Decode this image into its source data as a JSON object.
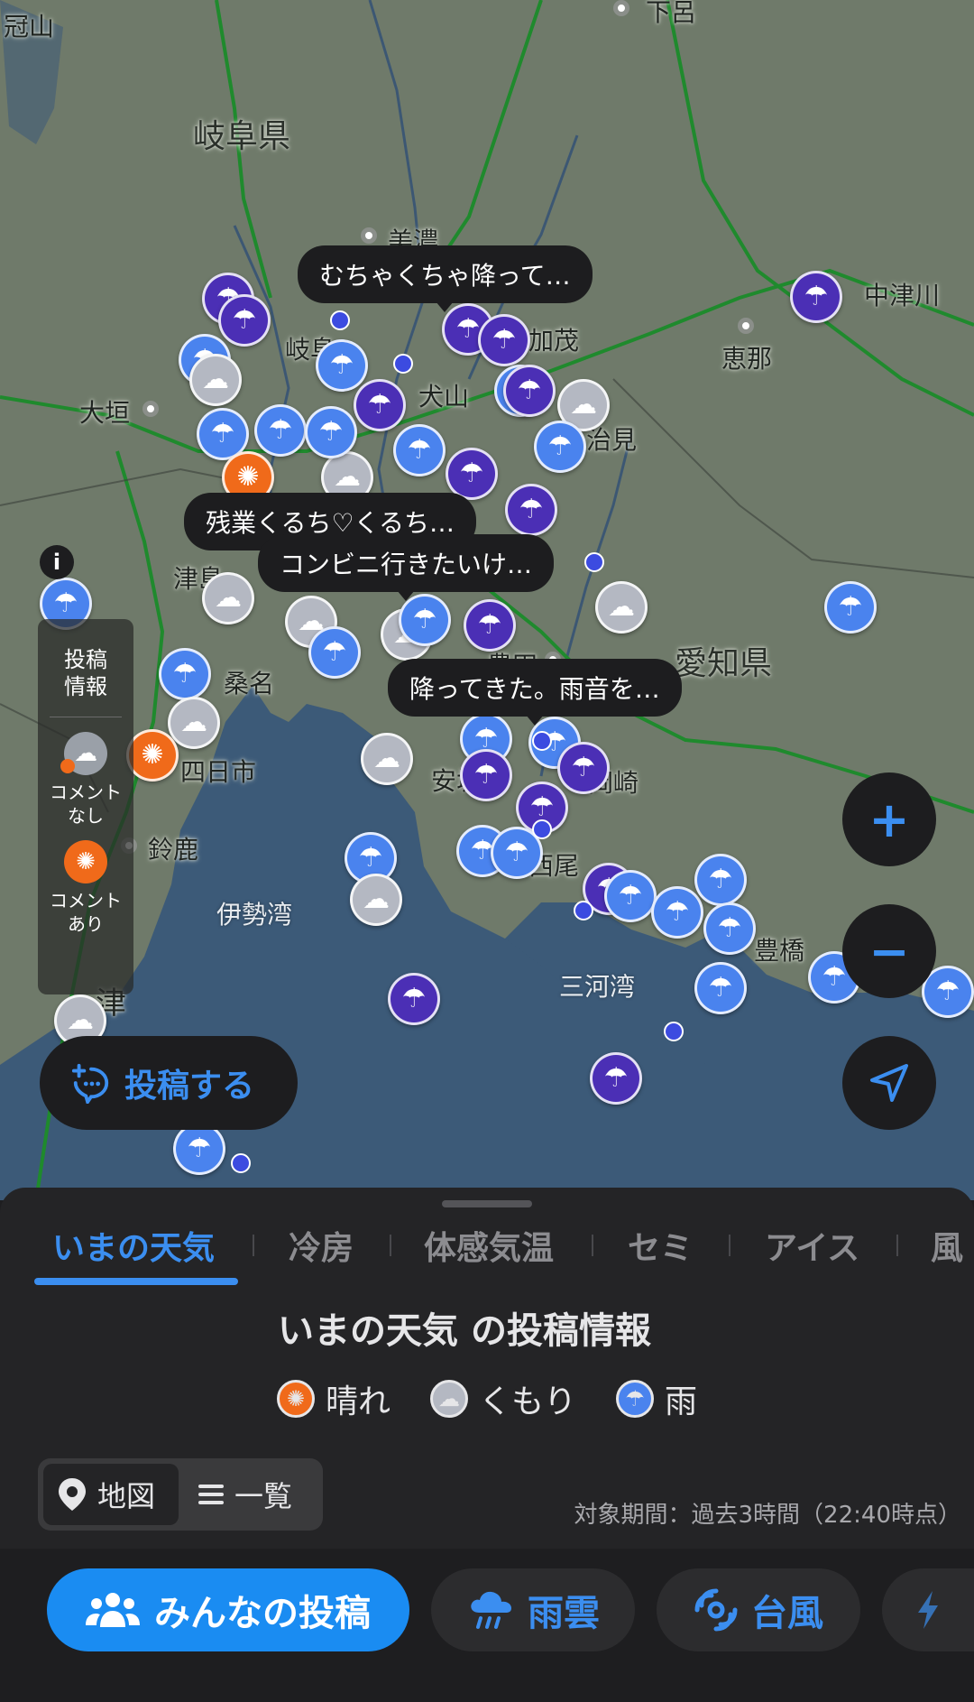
{
  "map": {
    "places": [
      {
        "id": "kanmuri",
        "text": "冠山"
      },
      {
        "id": "gero",
        "text": "下呂"
      },
      {
        "id": "gifu-pref",
        "text": "岐阜県"
      },
      {
        "id": "mino",
        "text": "美濃"
      },
      {
        "id": "gifu",
        "text": "岐阜"
      },
      {
        "id": "ogaki",
        "text": "大垣"
      },
      {
        "id": "kamo",
        "text": "加茂"
      },
      {
        "id": "inuyama",
        "text": "犬山"
      },
      {
        "id": "tajimi",
        "text": "多治見"
      },
      {
        "id": "nakatsugawa",
        "text": "中津川"
      },
      {
        "id": "ena",
        "text": "恵那"
      },
      {
        "id": "tsushima",
        "text": "津島"
      },
      {
        "id": "toyota",
        "text": "豊田"
      },
      {
        "id": "aichi-pref",
        "text": "愛知県"
      },
      {
        "id": "kuwana",
        "text": "桑名"
      },
      {
        "id": "yokkaichi",
        "text": "四日市"
      },
      {
        "id": "anjo",
        "text": "安城"
      },
      {
        "id": "okazaki",
        "text": "岡崎"
      },
      {
        "id": "suzuka",
        "text": "鈴鹿"
      },
      {
        "id": "nishio",
        "text": "西尾"
      },
      {
        "id": "ise-bay",
        "text": "伊勢湾"
      },
      {
        "id": "toyohashi",
        "text": "豊橋"
      },
      {
        "id": "tsu",
        "text": "津"
      },
      {
        "id": "mikawa-bay",
        "text": "三河湾"
      }
    ],
    "bubbles": [
      "むちゃくちゃ降って…",
      "残業くるち♡くるち…",
      "コンビニ行きたいけ…",
      "降ってきた。雨音を…"
    ],
    "info_label": "i",
    "legend": {
      "title": "投稿情報",
      "no_comment": "コメントなし",
      "with_comment": "コメントあり"
    },
    "post_button": "投稿する",
    "zoom_in": "+",
    "zoom_out": "−"
  },
  "sheet": {
    "tabs": [
      "いまの天気",
      "冷房",
      "体感気温",
      "セミ",
      "アイス",
      "風"
    ],
    "active_tab": "いまの天気",
    "title": "いまの天気 の投稿情報",
    "key": {
      "sunny": "晴れ",
      "cloudy": "くもり",
      "rain": "雨"
    },
    "view_toggle": {
      "map": "地図",
      "list": "一覧",
      "selected": "地図"
    },
    "period": "対象期間：過去3時間（22:40時点）"
  },
  "bottom_nav": {
    "everyone": "みんなの投稿",
    "rain_cloud": "雨雲",
    "typhoon": "台風"
  },
  "colors": {
    "accent": "#3b8ef0",
    "rain": "#4a83ee",
    "heavy_rain": "#4b2fb5",
    "cloud": "#b4b8c2",
    "sunny": "#f06a1a",
    "sea": "#3c5a78",
    "land": "#6f7a6a"
  }
}
